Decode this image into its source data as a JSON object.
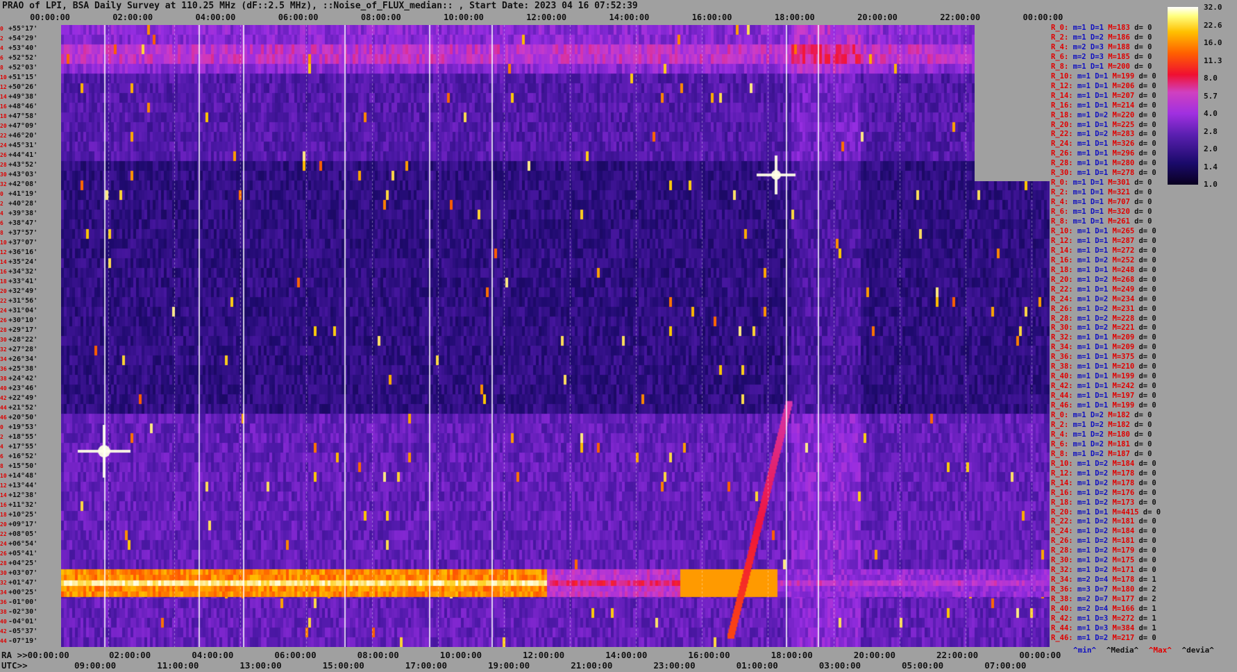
{
  "title": "PRAO of LPI, BSA Daily Survey at 110.25 MHz (dF::2.5 MHz), ::Noise_of_FLUX_median:: , Start Date: 2023 04 16 07:52:39",
  "top_ticks": [
    "00:00:00",
    "02:00:00",
    "04:00:00",
    "06:00:00",
    "08:00:00",
    "10:00:00",
    "12:00:00",
    "14:00:00",
    "16:00:00",
    "18:00:00",
    "20:00:00",
    "22:00:00",
    "00:00:00"
  ],
  "ra_prefix": "RA >>00:00:00",
  "ra_ticks": [
    "02:00:00",
    "04:00:00",
    "06:00:00",
    "08:00:00",
    "10:00:00",
    "12:00:00",
    "14:00:00",
    "16:00:00",
    "18:00:00",
    "20:00:00",
    "22:00:00",
    "00:00:00"
  ],
  "utc_prefix": "UTC>>",
  "utc_ticks": [
    "09:00:00",
    "11:00:00",
    "13:00:00",
    "15:00:00",
    "17:00:00",
    "19:00:00",
    "21:00:00",
    "23:00:00",
    "01:00:00",
    "03:00:00",
    "05:00:00",
    "07:00:00"
  ],
  "colorbar": {
    "labels": [
      "32.0",
      "22.6",
      "16.0",
      "11.3",
      "8.0",
      "5.7",
      "4.0",
      "2.8",
      "2.0",
      "1.4",
      "1.0"
    ]
  },
  "legend": {
    "min": "^min^",
    "median": "^Media^",
    "max": "^Max^",
    "devia": "^devia^",
    "min_color": "#1010c0",
    "max_color": "#e00000"
  },
  "dec_labels": [
    {
      "i": "0",
      "d": "+55°17'"
    },
    {
      "i": "2",
      "d": "+54°29'"
    },
    {
      "i": "4",
      "d": "+53°40'"
    },
    {
      "i": "6",
      "d": "+52°52'"
    },
    {
      "i": "8",
      "d": "+52°03'"
    },
    {
      "i": "10",
      "d": "+51°15'"
    },
    {
      "i": "12",
      "d": "+50°26'"
    },
    {
      "i": "14",
      "d": "+49°38'"
    },
    {
      "i": "16",
      "d": "+48°46'"
    },
    {
      "i": "18",
      "d": "+47°58'"
    },
    {
      "i": "20",
      "d": "+47°09'"
    },
    {
      "i": "22",
      "d": "+46°20'"
    },
    {
      "i": "24",
      "d": "+45°31'"
    },
    {
      "i": "26",
      "d": "+44°41'"
    },
    {
      "i": "28",
      "d": "+43°52'"
    },
    {
      "i": "30",
      "d": "+43°03'"
    },
    {
      "i": "32",
      "d": "+42°08'"
    },
    {
      "i": "0",
      "d": "+41°19'"
    },
    {
      "i": "2",
      "d": "+40°28'"
    },
    {
      "i": "4",
      "d": "+39°38'"
    },
    {
      "i": "6",
      "d": "+38°47'"
    },
    {
      "i": "8",
      "d": "+37°57'"
    },
    {
      "i": "10",
      "d": "+37°07'"
    },
    {
      "i": "12",
      "d": "+36°16'"
    },
    {
      "i": "14",
      "d": "+35°24'"
    },
    {
      "i": "16",
      "d": "+34°32'"
    },
    {
      "i": "18",
      "d": "+33°41'"
    },
    {
      "i": "20",
      "d": "+32°49'"
    },
    {
      "i": "22",
      "d": "+31°56'"
    },
    {
      "i": "24",
      "d": "+31°04'"
    },
    {
      "i": "26",
      "d": "+30°10'"
    },
    {
      "i": "28",
      "d": "+29°17'"
    },
    {
      "i": "30",
      "d": "+28°22'"
    },
    {
      "i": "32",
      "d": "+27°28'"
    },
    {
      "i": "34",
      "d": "+26°34'"
    },
    {
      "i": "36",
      "d": "+25°38'"
    },
    {
      "i": "38",
      "d": "+24°42'"
    },
    {
      "i": "40",
      "d": "+23°46'"
    },
    {
      "i": "42",
      "d": "+22°49'"
    },
    {
      "i": "44",
      "d": "+21°52'"
    },
    {
      "i": "46",
      "d": "+20°50'"
    },
    {
      "i": "0",
      "d": "+19°53'"
    },
    {
      "i": "2",
      "d": "+18°55'"
    },
    {
      "i": "4",
      "d": "+17°55'"
    },
    {
      "i": "6",
      "d": "+16°52'"
    },
    {
      "i": "8",
      "d": "+15°50'"
    },
    {
      "i": "10",
      "d": "+14°48'"
    },
    {
      "i": "12",
      "d": "+13°44'"
    },
    {
      "i": "14",
      "d": "+12°38'"
    },
    {
      "i": "16",
      "d": "+11°32'"
    },
    {
      "i": "18",
      "d": "+10°25'"
    },
    {
      "i": "20",
      "d": "+09°17'"
    },
    {
      "i": "22",
      "d": "+08°05'"
    },
    {
      "i": "24",
      "d": "+06°54'"
    },
    {
      "i": "26",
      "d": "+05°41'"
    },
    {
      "i": "28",
      "d": "+04°25'"
    },
    {
      "i": "30",
      "d": "+03°07'"
    },
    {
      "i": "32",
      "d": "+01°47'"
    },
    {
      "i": "34",
      "d": "+00°25'"
    },
    {
      "i": "36",
      "d": "-01°00'"
    },
    {
      "i": "38",
      "d": "-02°30'"
    },
    {
      "i": "40",
      "d": "-04°01'"
    },
    {
      "i": "42",
      "d": "-05°37'"
    },
    {
      "i": "44",
      "d": "-07°19'"
    }
  ],
  "stats": [
    {
      "r": "R_0:",
      "m": "m=1",
      "D": "D=1",
      "M": "M=183",
      "d": "d= 0"
    },
    {
      "r": "R_2:",
      "m": "m=1",
      "D": "D=2",
      "M": "M=186",
      "d": "d= 0"
    },
    {
      "r": "R_4:",
      "m": "m=2",
      "D": "D=3",
      "M": "M=188",
      "d": "d= 0"
    },
    {
      "r": "R_6:",
      "m": "m=2",
      "D": "D=3",
      "M": "M=185",
      "d": "d= 0"
    },
    {
      "r": "R_8:",
      "m": "m=1",
      "D": "D=1",
      "M": "M=200",
      "d": "d= 0"
    },
    {
      "r": "R_10:",
      "m": "m=1",
      "D": "D=1",
      "M": "M=199",
      "d": "d= 0"
    },
    {
      "r": "R_12:",
      "m": "m=1",
      "D": "D=1",
      "M": "M=206",
      "d": "d= 0"
    },
    {
      "r": "R_14:",
      "m": "m=1",
      "D": "D=1",
      "M": "M=207",
      "d": "d= 0"
    },
    {
      "r": "R_16:",
      "m": "m=1",
      "D": "D=1",
      "M": "M=214",
      "d": "d= 0"
    },
    {
      "r": "R_18:",
      "m": "m=1",
      "D": "D=2",
      "M": "M=220",
      "d": "d= 0"
    },
    {
      "r": "R_20:",
      "m": "m=1",
      "D": "D=1",
      "M": "M=225",
      "d": "d= 0"
    },
    {
      "r": "R_22:",
      "m": "m=1",
      "D": "D=2",
      "M": "M=283",
      "d": "d= 0"
    },
    {
      "r": "R_24:",
      "m": "m=1",
      "D": "D=1",
      "M": "M=326",
      "d": "d= 0"
    },
    {
      "r": "R_26:",
      "m": "m=1",
      "D": "D=1",
      "M": "M=296",
      "d": "d= 0"
    },
    {
      "r": "R_28:",
      "m": "m=1",
      "D": "D=1",
      "M": "M=280",
      "d": "d= 0"
    },
    {
      "r": "R_30:",
      "m": "m=1",
      "D": "D=1",
      "M": "M=278",
      "d": "d= 0"
    },
    {
      "r": "R_0:",
      "m": "m=1",
      "D": "D=1",
      "M": "M=301",
      "d": "d= 0"
    },
    {
      "r": "R_2:",
      "m": "m=1",
      "D": "D=1",
      "M": "M=321",
      "d": "d= 0"
    },
    {
      "r": "R_4:",
      "m": "m=1",
      "D": "D=1",
      "M": "M=707",
      "d": "d= 0"
    },
    {
      "r": "R_6:",
      "m": "m=1",
      "D": "D=1",
      "M": "M=320",
      "d": "d= 0"
    },
    {
      "r": "R_8:",
      "m": "m=1",
      "D": "D=1",
      "M": "M=261",
      "d": "d= 0"
    },
    {
      "r": "R_10:",
      "m": "m=1",
      "D": "D=1",
      "M": "M=265",
      "d": "d= 0"
    },
    {
      "r": "R_12:",
      "m": "m=1",
      "D": "D=1",
      "M": "M=287",
      "d": "d= 0"
    },
    {
      "r": "R_14:",
      "m": "m=1",
      "D": "D=1",
      "M": "M=272",
      "d": "d= 0"
    },
    {
      "r": "R_16:",
      "m": "m=1",
      "D": "D=2",
      "M": "M=252",
      "d": "d= 0"
    },
    {
      "r": "R_18:",
      "m": "m=1",
      "D": "D=1",
      "M": "M=248",
      "d": "d= 0"
    },
    {
      "r": "R_20:",
      "m": "m=1",
      "D": "D=2",
      "M": "M=268",
      "d": "d= 0"
    },
    {
      "r": "R_22:",
      "m": "m=1",
      "D": "D=1",
      "M": "M=249",
      "d": "d= 0"
    },
    {
      "r": "R_24:",
      "m": "m=1",
      "D": "D=2",
      "M": "M=234",
      "d": "d= 0"
    },
    {
      "r": "R_26:",
      "m": "m=1",
      "D": "D=2",
      "M": "M=231",
      "d": "d= 0"
    },
    {
      "r": "R_28:",
      "m": "m=1",
      "D": "D=2",
      "M": "M=228",
      "d": "d= 0"
    },
    {
      "r": "R_30:",
      "m": "m=1",
      "D": "D=2",
      "M": "M=221",
      "d": "d= 0"
    },
    {
      "r": "R_32:",
      "m": "m=1",
      "D": "D=1",
      "M": "M=209",
      "d": "d= 0"
    },
    {
      "r": "R_34:",
      "m": "m=1",
      "D": "D=1",
      "M": "M=209",
      "d": "d= 0"
    },
    {
      "r": "R_36:",
      "m": "m=1",
      "D": "D=1",
      "M": "M=375",
      "d": "d= 0"
    },
    {
      "r": "R_38:",
      "m": "m=1",
      "D": "D=1",
      "M": "M=210",
      "d": "d= 0"
    },
    {
      "r": "R_40:",
      "m": "m=1",
      "D": "D=1",
      "M": "M=199",
      "d": "d= 0"
    },
    {
      "r": "R_42:",
      "m": "m=1",
      "D": "D=1",
      "M": "M=242",
      "d": "d= 0"
    },
    {
      "r": "R_44:",
      "m": "m=1",
      "D": "D=1",
      "M": "M=197",
      "d": "d= 0"
    },
    {
      "r": "R_46:",
      "m": "m=1",
      "D": "D=1",
      "M": "M=199",
      "d": "d= 0"
    },
    {
      "r": "R_0:",
      "m": "m=1",
      "D": "D=2",
      "M": "M=182",
      "d": "d= 0"
    },
    {
      "r": "R_2:",
      "m": "m=1",
      "D": "D=2",
      "M": "M=182",
      "d": "d= 0"
    },
    {
      "r": "R_4:",
      "m": "m=1",
      "D": "D=2",
      "M": "M=180",
      "d": "d= 0"
    },
    {
      "r": "R_6:",
      "m": "m=1",
      "D": "D=2",
      "M": "M=181",
      "d": "d= 0"
    },
    {
      "r": "R_8:",
      "m": "m=1",
      "D": "D=2",
      "M": "M=187",
      "d": "d= 0"
    },
    {
      "r": "R_10:",
      "m": "m=1",
      "D": "D=2",
      "M": "M=184",
      "d": "d= 0"
    },
    {
      "r": "R_12:",
      "m": "m=1",
      "D": "D=2",
      "M": "M=178",
      "d": "d= 0"
    },
    {
      "r": "R_14:",
      "m": "m=1",
      "D": "D=2",
      "M": "M=178",
      "d": "d= 0"
    },
    {
      "r": "R_16:",
      "m": "m=1",
      "D": "D=2",
      "M": "M=176",
      "d": "d= 0"
    },
    {
      "r": "R_18:",
      "m": "m=1",
      "D": "D=2",
      "M": "M=173",
      "d": "d= 0"
    },
    {
      "r": "R_20:",
      "m": "m=1",
      "D": "D=1",
      "M": "M=4415",
      "d": "d= 0"
    },
    {
      "r": "R_22:",
      "m": "m=1",
      "D": "D=2",
      "M": "M=181",
      "d": "d= 0"
    },
    {
      "r": "R_24:",
      "m": "m=1",
      "D": "D=2",
      "M": "M=184",
      "d": "d= 0"
    },
    {
      "r": "R_26:",
      "m": "m=1",
      "D": "D=2",
      "M": "M=181",
      "d": "d= 0"
    },
    {
      "r": "R_28:",
      "m": "m=1",
      "D": "D=2",
      "M": "M=179",
      "d": "d= 0"
    },
    {
      "r": "R_30:",
      "m": "m=1",
      "D": "D=2",
      "M": "M=175",
      "d": "d= 0"
    },
    {
      "r": "R_32:",
      "m": "m=1",
      "D": "D=2",
      "M": "M=171",
      "d": "d= 0"
    },
    {
      "r": "R_34:",
      "m": "m=2",
      "D": "D=4",
      "M": "M=178",
      "d": "d= 1"
    },
    {
      "r": "R_36:",
      "m": "m=3",
      "D": "D=7",
      "M": "M=180",
      "d": "d= 2"
    },
    {
      "r": "R_38:",
      "m": "m=2",
      "D": "D=7",
      "M": "M=177",
      "d": "d= 2"
    },
    {
      "r": "R_40:",
      "m": "m=2",
      "D": "D=4",
      "M": "M=166",
      "d": "d= 1"
    },
    {
      "r": "R_42:",
      "m": "m=1",
      "D": "D=3",
      "M": "M=272",
      "d": "d= 1"
    },
    {
      "r": "R_44:",
      "m": "m=1",
      "D": "D=3",
      "M": "M=384",
      "d": "d= 1"
    },
    {
      "r": "R_46:",
      "m": "m=1",
      "D": "D=2",
      "M": "M=217",
      "d": "d= 0"
    }
  ]
}
